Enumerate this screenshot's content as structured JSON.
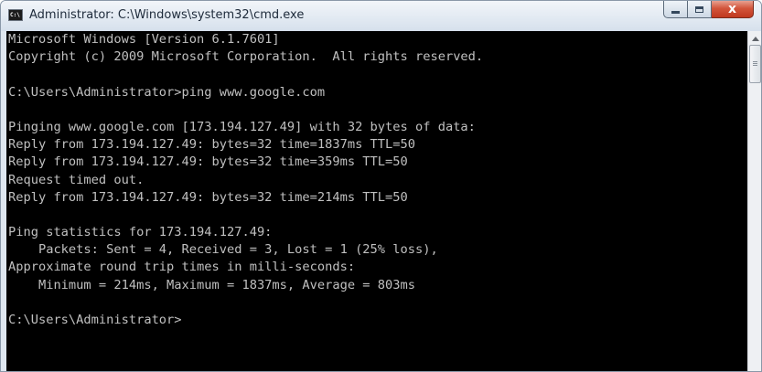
{
  "window": {
    "title": "Administrator: C:\\Windows\\system32\\cmd.exe",
    "icon": "cmd-icon",
    "icon_text": "C:\\",
    "controls": {
      "minimize": "minimize-icon",
      "maximize": "maximize-icon",
      "close_glyph": "x"
    }
  },
  "colors": {
    "console_bg": "#000000",
    "console_fg": "#c0c0c0",
    "close_button": "#c9452c"
  },
  "console": {
    "lines": [
      "Microsoft Windows [Version 6.1.7601]",
      "Copyright (c) 2009 Microsoft Corporation.  All rights reserved.",
      "",
      "C:\\Users\\Administrator>ping www.google.com",
      "",
      "Pinging www.google.com [173.194.127.49] with 32 bytes of data:",
      "Reply from 173.194.127.49: bytes=32 time=1837ms TTL=50",
      "Reply from 173.194.127.49: bytes=32 time=359ms TTL=50",
      "Request timed out.",
      "Reply from 173.194.127.49: bytes=32 time=214ms TTL=50",
      "",
      "Ping statistics for 173.194.127.49:",
      "    Packets: Sent = 4, Received = 3, Lost = 1 (25% loss),",
      "Approximate round trip times in milli-seconds:",
      "    Minimum = 214ms, Maximum = 1837ms, Average = 803ms",
      "",
      "C:\\Users\\Administrator>"
    ]
  },
  "scrollbar": {
    "up_arrow": "up-arrow-icon",
    "thumb_grip": "grip-icon"
  }
}
